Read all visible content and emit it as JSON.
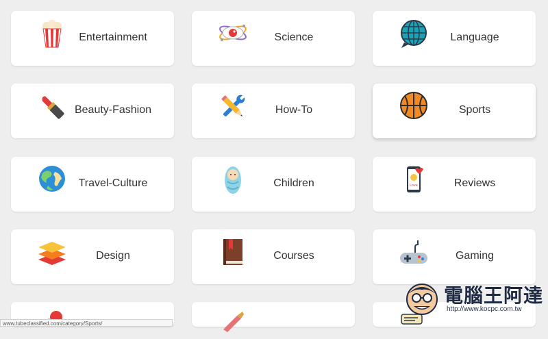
{
  "categories": [
    {
      "label": "Entertainment",
      "icon": "popcorn-icon"
    },
    {
      "label": "Science",
      "icon": "atom-eye-icon"
    },
    {
      "label": "Language",
      "icon": "globe-speech-icon"
    },
    {
      "label": "Beauty-Fashion",
      "icon": "lipstick-icon"
    },
    {
      "label": "How-To",
      "icon": "tools-icon"
    },
    {
      "label": "Sports",
      "icon": "basketball-icon"
    },
    {
      "label": "Travel-Culture",
      "icon": "earth-icon"
    },
    {
      "label": "Children",
      "icon": "baby-icon"
    },
    {
      "label": "Reviews",
      "icon": "phone-love-icon"
    },
    {
      "label": "Design",
      "icon": "layers-icon"
    },
    {
      "label": "Courses",
      "icon": "book-icon"
    },
    {
      "label": "Gaming",
      "icon": "gamepad-icon"
    }
  ],
  "status_url": "www.tubeclassified.com/category/Sports/",
  "watermark": {
    "title": "電腦王阿達",
    "url": "http://www.kocpc.com.tw"
  }
}
